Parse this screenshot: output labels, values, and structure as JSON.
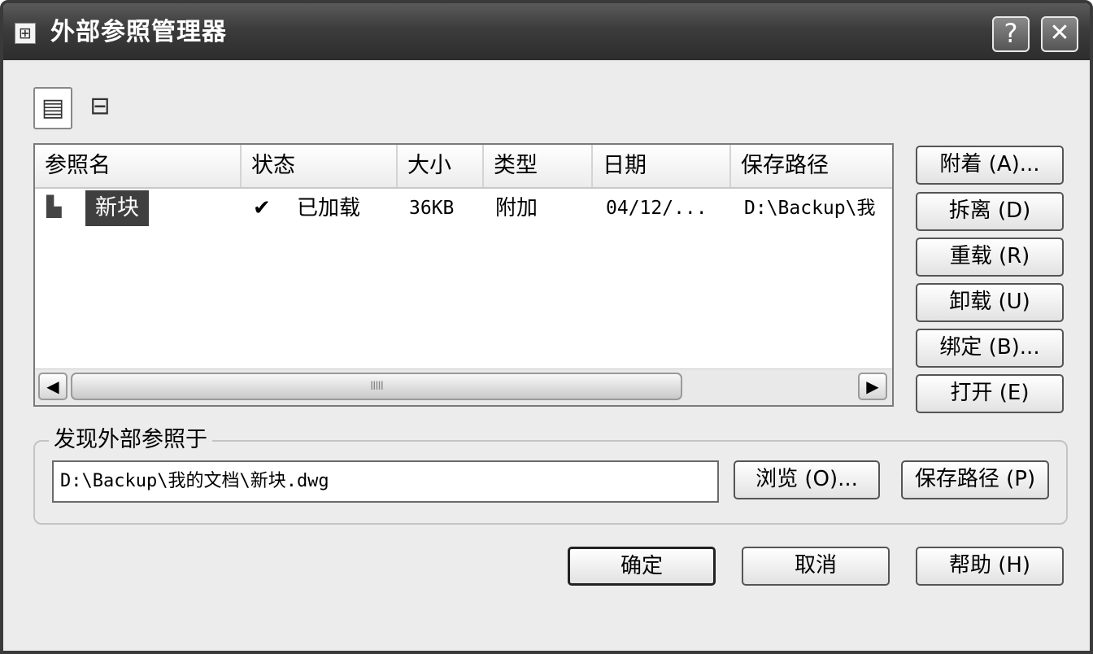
{
  "window": {
    "title": "外部参照管理器",
    "help_glyph": "?",
    "close_glyph": "✕"
  },
  "view_toggle": {
    "list_view_icon": "list-view-icon",
    "tree_view_icon": "tree-view-icon"
  },
  "table": {
    "columns": [
      "参照名",
      "状态",
      "大小",
      "类型",
      "日期",
      "保存路径"
    ],
    "rows": [
      {
        "icon": "xref-drawing-icon",
        "name": "新块",
        "status_check": "✔",
        "status": "已加载",
        "size": "36KB",
        "type": "附加",
        "date": "04/12/...",
        "path": "D:\\Backup\\我"
      }
    ],
    "scroll": {
      "left_arrow": "◀",
      "right_arrow": "▶",
      "thumb_grip": "IIIII"
    }
  },
  "side_buttons": {
    "attach": "附着 (A)...",
    "detach": "拆离 (D)",
    "reload": "重载 (R)",
    "unload": "卸载 (U)",
    "bind": "绑定 (B)...",
    "open": "打开 (E)"
  },
  "found_in": {
    "label": "发现外部参照于",
    "path": "D:\\Backup\\我的文档\\新块.dwg",
    "browse": "浏览 (O)...",
    "save_path": "保存路径 (P)"
  },
  "footer": {
    "ok": "确定",
    "cancel": "取消",
    "help": "帮助 (H)"
  }
}
